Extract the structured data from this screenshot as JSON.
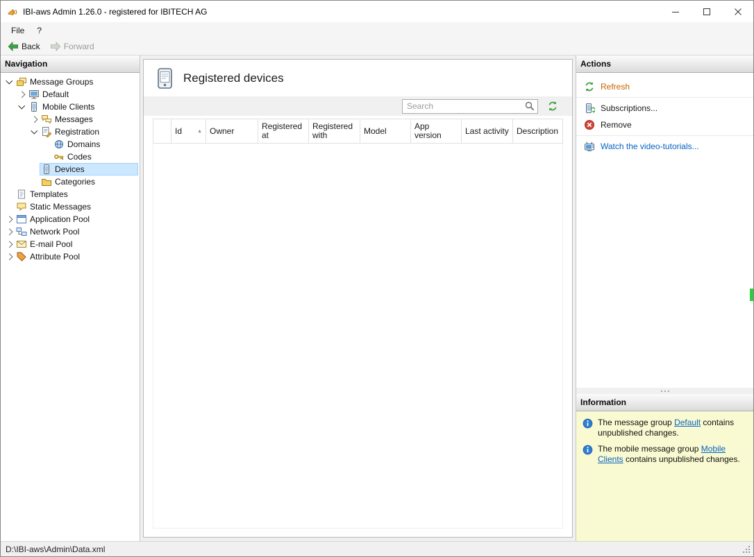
{
  "window": {
    "title": "IBI-aws Admin 1.26.0 - registered for IBITECH AG"
  },
  "menu": {
    "items": [
      {
        "label": "File"
      },
      {
        "label": "?"
      }
    ]
  },
  "toolbar": {
    "back_label": "Back",
    "forward_label": "Forward"
  },
  "navigation": {
    "header": "Navigation",
    "tree": [
      {
        "label": "Message Groups",
        "level": 0,
        "state": "expanded",
        "icon": "message-groups-icon",
        "selected": false
      },
      {
        "label": "Default",
        "level": 1,
        "state": "collapsed",
        "icon": "computer-group-icon",
        "selected": false
      },
      {
        "label": "Mobile Clients",
        "level": 1,
        "state": "expanded",
        "icon": "mobile-clients-icon",
        "selected": false
      },
      {
        "label": "Messages",
        "level": 2,
        "state": "collapsed",
        "icon": "messages-icon",
        "selected": false
      },
      {
        "label": "Registration",
        "level": 2,
        "state": "expanded",
        "icon": "registration-icon",
        "selected": false
      },
      {
        "label": "Domains",
        "level": 3,
        "state": "leaf",
        "icon": "domains-icon",
        "selected": false
      },
      {
        "label": "Codes",
        "level": 3,
        "state": "leaf",
        "icon": "codes-icon",
        "selected": false
      },
      {
        "label": "Devices",
        "level": 2,
        "state": "leaf",
        "icon": "devices-icon",
        "selected": true
      },
      {
        "label": "Categories",
        "level": 2,
        "state": "leaf",
        "icon": "categories-icon",
        "selected": false
      },
      {
        "label": "Templates",
        "level": 0,
        "state": "leaf",
        "icon": "templates-icon",
        "selected": false
      },
      {
        "label": "Static Messages",
        "level": 0,
        "state": "leaf",
        "icon": "static-messages-icon",
        "selected": false
      },
      {
        "label": "Application Pool",
        "level": 0,
        "state": "collapsed",
        "icon": "application-pool-icon",
        "selected": false
      },
      {
        "label": "Network Pool",
        "level": 0,
        "state": "collapsed",
        "icon": "network-pool-icon",
        "selected": false
      },
      {
        "label": "E-mail Pool",
        "level": 0,
        "state": "collapsed",
        "icon": "e-mail-pool-icon",
        "selected": false
      },
      {
        "label": "Attribute Pool",
        "level": 0,
        "state": "collapsed",
        "icon": "attribute-pool-icon",
        "selected": false
      }
    ]
  },
  "main": {
    "title": "Registered devices",
    "icon": "registered-devices-icon",
    "search": {
      "placeholder": "Search",
      "icons": [
        "search-icon",
        "refresh-icon"
      ]
    },
    "table": {
      "columns": [
        "Id",
        "Owner",
        "Registered at",
        "Registered with",
        "Model",
        "App version",
        "Last activity",
        "Description"
      ],
      "sort": {
        "column": "Id",
        "direction": "ascending"
      },
      "rows": []
    }
  },
  "actions": {
    "header": "Actions",
    "items": [
      {
        "label": "Refresh",
        "icon": "refresh-icon",
        "color": "#c66200"
      },
      {
        "label": "Subscriptions...",
        "icon": "subscriptions-icon"
      },
      {
        "label": "Remove",
        "icon": "remove-icon"
      },
      {
        "label": "Watch the video-tutorials...",
        "icon": "video-tutorials-icon",
        "color": "#0563c1"
      }
    ]
  },
  "information": {
    "header": "Information",
    "messages": [
      {
        "icon": "info-icon",
        "prefix": "The message group ",
        "link": "Default",
        "suffix": " contains unpublished changes."
      },
      {
        "icon": "info-icon",
        "prefix": "The mobile message group ",
        "link": "Mobile Clients",
        "suffix": " contains unpublished changes."
      }
    ]
  },
  "statusbar": {
    "file_path": "D:\\IBI-aws\\Admin\\Data.xml"
  },
  "colors": {
    "selection_fill": "#cce8ff",
    "selection_border": "#99d1ff",
    "accent_link": "#c66200",
    "hyperlink": "#0563c1",
    "info_panel_background": "#fafad2"
  }
}
